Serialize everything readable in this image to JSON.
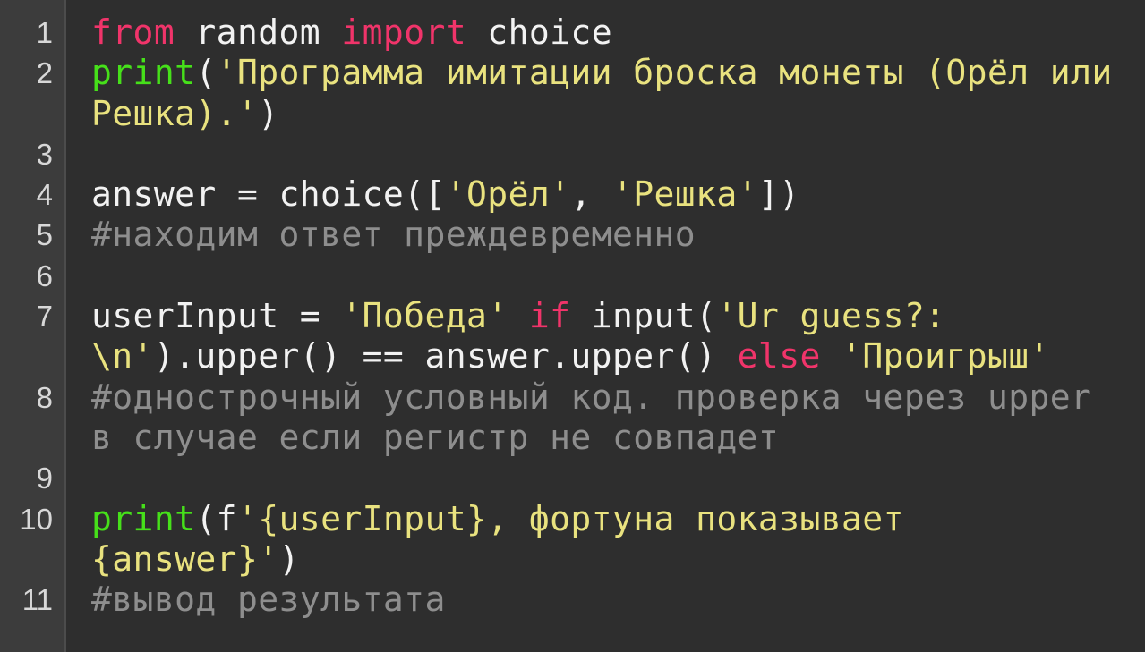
{
  "colors": {
    "background": "#2e2e2e",
    "gutter_background": "#3c3c3c",
    "gutter_border": "#4c4c4c",
    "line_number": "#d8d8d8",
    "keyword": "#f0346a",
    "builtin_function": "#46e01a",
    "string": "#e9e27f",
    "comment": "#8e8e8e",
    "plain": "#f2f2f2"
  },
  "gutter": {
    "rows": [
      "1",
      "2",
      "",
      "3",
      "4",
      "5",
      "6",
      "7",
      "",
      "8",
      "",
      "9",
      "10",
      "",
      "11"
    ]
  },
  "code": {
    "rows": [
      [
        {
          "cls": "kw",
          "text": "from"
        },
        {
          "cls": "pl",
          "text": " random "
        },
        {
          "cls": "kw",
          "text": "import"
        },
        {
          "cls": "pl",
          "text": " choice"
        }
      ],
      [
        {
          "cls": "fn",
          "text": "print"
        },
        {
          "cls": "pl",
          "text": "("
        },
        {
          "cls": "str",
          "text": "'Программа имитации броска монеты (Орёл или"
        }
      ],
      [
        {
          "cls": "str",
          "text": "Решка).'"
        },
        {
          "cls": "pl",
          "text": ")"
        }
      ],
      [],
      [
        {
          "cls": "pl",
          "text": "answer = choice(["
        },
        {
          "cls": "str",
          "text": "'Орёл'"
        },
        {
          "cls": "pl",
          "text": ", "
        },
        {
          "cls": "str",
          "text": "'Решка'"
        },
        {
          "cls": "pl",
          "text": "])"
        }
      ],
      [
        {
          "cls": "cm",
          "text": "#находим ответ преждевременно"
        }
      ],
      [],
      [
        {
          "cls": "pl",
          "text": "userInput = "
        },
        {
          "cls": "str",
          "text": "'Победа'"
        },
        {
          "cls": "pl",
          "text": " "
        },
        {
          "cls": "kw",
          "text": "if"
        },
        {
          "cls": "pl",
          "text": " input("
        },
        {
          "cls": "str",
          "text": "'Ur guess?:"
        }
      ],
      [
        {
          "cls": "str",
          "text": "\\n'"
        },
        {
          "cls": "pl",
          "text": ").upper() == answer.upper() "
        },
        {
          "cls": "kw",
          "text": "else"
        },
        {
          "cls": "pl",
          "text": " "
        },
        {
          "cls": "str",
          "text": "'Проигрыш'"
        }
      ],
      [
        {
          "cls": "cm",
          "text": "#однострочный условный код. проверка через upper"
        }
      ],
      [
        {
          "cls": "cm",
          "text": "в случае если регистр не совпадет"
        }
      ],
      [],
      [
        {
          "cls": "fn",
          "text": "print"
        },
        {
          "cls": "pl",
          "text": "(f"
        },
        {
          "cls": "str",
          "text": "'{userInput}, фортуна показывает"
        }
      ],
      [
        {
          "cls": "str",
          "text": "{answer}'"
        },
        {
          "cls": "pl",
          "text": ")"
        }
      ],
      [
        {
          "cls": "cm",
          "text": "#вывод результата"
        }
      ]
    ]
  }
}
